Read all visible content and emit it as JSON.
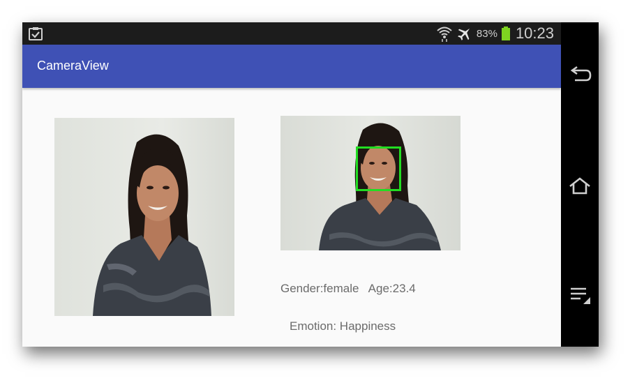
{
  "status_bar": {
    "battery_percent": "83%",
    "time": "10:23",
    "icons": [
      "clipboard-check-icon",
      "wifi-icon",
      "airplane-mode-icon",
      "battery-icon"
    ],
    "battery_color": "#7ed321"
  },
  "app_bar": {
    "title": "CameraView",
    "color": "#3f51b5"
  },
  "results": {
    "gender_age": "Gender:female   Age:23.4",
    "emotion": "Emotion: Happiness"
  },
  "face_box_color": "#22dd22",
  "nav_bar": {
    "buttons": [
      "back-icon",
      "home-icon",
      "recent-apps-icon"
    ]
  }
}
